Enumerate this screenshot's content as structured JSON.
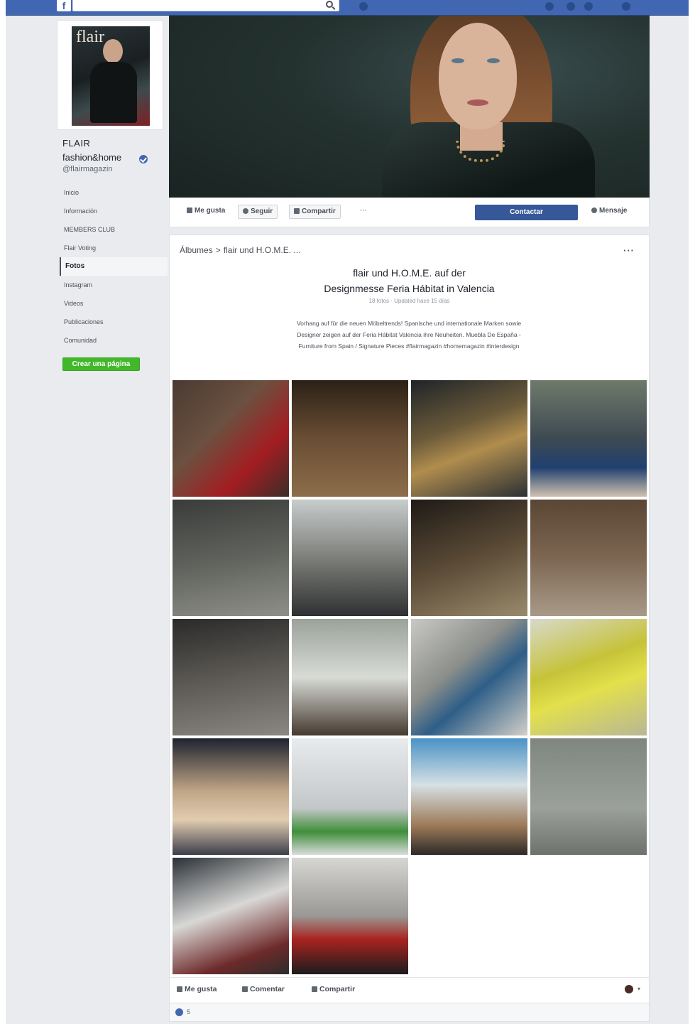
{
  "search": {
    "placeholder": ""
  },
  "sidebar": {
    "name_line1": "FLAIR",
    "name_line2": "fashion&home",
    "handle": "@flairmagazin",
    "profile_title": "flair",
    "items": [
      {
        "label": "Inicio"
      },
      {
        "label": "Información"
      },
      {
        "label": "MEMBERS CLUB"
      },
      {
        "label": "Flair Voting"
      },
      {
        "label": "Fotos",
        "active": true
      },
      {
        "label": "Instagram"
      },
      {
        "label": "Videos"
      },
      {
        "label": "Publicaciones"
      },
      {
        "label": "Comunidad"
      }
    ],
    "create_page": "Crear una página"
  },
  "actions": {
    "like": "Me gusta",
    "follow": "Seguir",
    "share": "Compartir",
    "more": "···",
    "contact": "Contactar",
    "message": "Mensaje"
  },
  "album": {
    "breadcrumb_root": "Álbumes",
    "breadcrumb_sep": ">",
    "breadcrumb_current": "flair und H.O.M.E. ...",
    "menu": "···",
    "title_line1": "flair und H.O.M.E. auf der",
    "title_line2": "Designmesse Feria Hábitat in Valencia",
    "meta": "18 fotos · Updated hace 15 días",
    "description_line1": "Vorhang auf für die neuen Möbeltrends! Spanische und internationale Marken sowie",
    "description_line2": "Designer zeigen auf der Feria Hábitat Valencia ihre Neuheiten. Muebla De España -",
    "description_line3": "Furniture from Spain / Signature Pieces #flairmagazin #homemagazin #interdesign"
  },
  "photos": [
    {
      "label": "photo-red-lounge",
      "bg": "linear-gradient(135deg,#4a3a32 0%,#6b5140 40%,#a31d22 70%,#3a2e28 100%)"
    },
    {
      "label": "photo-pendant-lights",
      "bg": "linear-gradient(180deg,#2b2116 0%,#6a4e34 50%,#8d6d4a 100%)"
    },
    {
      "label": "photo-gold-installation",
      "bg": "linear-gradient(160deg,#1f2428 0%,#6b5a3a 40%,#b08d4e 60%,#2c3034 100%)"
    },
    {
      "label": "photo-blue-chairs",
      "bg": "linear-gradient(180deg,#6f7a6b 0%,#3e4a52 50%,#20406f 75%,#cfc2b0 100%)"
    },
    {
      "label": "photo-grey-booth",
      "bg": "linear-gradient(170deg,#3a3c3a 0%,#5f625c 50%,#8e8f88 100%)"
    },
    {
      "label": "photo-round-table",
      "bg": "linear-gradient(180deg,#c7cccd 0%,#7d7f7a 50%,#2f3032 100%)"
    },
    {
      "label": "photo-light-strands",
      "bg": "linear-gradient(160deg,#1e1a16 0%,#5a4a36 50%,#9a8a6c 100%)"
    },
    {
      "label": "photo-white-pendants",
      "bg": "linear-gradient(180deg,#5a4634 0%,#7c6652 50%,#a89a88 100%)"
    },
    {
      "label": "photo-dark-showroom",
      "bg": "linear-gradient(170deg,#2a2a2a 0%,#5d5a55 50%,#8a8680 100%)"
    },
    {
      "label": "photo-bathroom-vanity",
      "bg": "linear-gradient(180deg,#9aa29a 0%,#d8dbd6 50%,#463a30 100%)"
    },
    {
      "label": "photo-blue-panels",
      "bg": "linear-gradient(140deg,#c9c9c4 0%,#8b8e8a 40%,#2e5e87 60%,#d2cfc8 100%)"
    },
    {
      "label": "photo-yellow-fish",
      "bg": "linear-gradient(160deg,#d8d9cc 0%,#c6c33a 40%,#e3e04c 60%,#b8b796 100%)"
    },
    {
      "label": "photo-wicker-lamps",
      "bg": "linear-gradient(180deg,#1f2330 0%,#bfa585 45%,#e1ccb0 70%,#3b3e4a 100%)"
    },
    {
      "label": "photo-white-daybed",
      "bg": "linear-gradient(180deg,#e8ebed 0%,#c3c7c8 60%,#3f8f3a 80%,#d9dbdc 100%)"
    },
    {
      "label": "photo-beach-screen",
      "bg": "linear-gradient(180deg,#4a92c6 0%,#d6e0e4 40%,#9c7a58 75%,#2c2a28 100%)"
    },
    {
      "label": "photo-grey-wall-taps",
      "bg": "linear-gradient(180deg,#7f8680 0%,#9ba19a 60%,#6d726c 100%)"
    },
    {
      "label": "photo-capdell-booth",
      "bg": "linear-gradient(160deg,#2a3036 0%,#d8d8d6 45%,#6d2a2a 80%,#2c2c2c 100%)"
    },
    {
      "label": "photo-sofa-showroom",
      "bg": "linear-gradient(180deg,#d6d6d2 0%,#9a9894 50%,#a8231f 70%,#1c1c1e 100%)"
    }
  ],
  "footer": {
    "like": "Me gusta",
    "comment": "Comentar",
    "share": "Compartir",
    "caret": "▾"
  },
  "reactions": {
    "count": "5"
  },
  "colors": {
    "brand": "#4267b2",
    "contact_button": "#365899",
    "create_button": "#42b72a",
    "background": "#e9ebee"
  }
}
